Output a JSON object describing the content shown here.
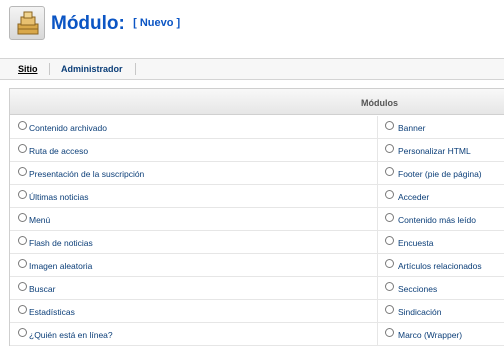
{
  "header": {
    "title": "Módulo:",
    "subtitle": "[ Nuevo ]",
    "icon": "module-manager-icon"
  },
  "tabs": [
    {
      "label": "Sitio",
      "active": true
    },
    {
      "label": "Administrador",
      "active": false
    }
  ],
  "panel": {
    "header": "Módulos",
    "left": [
      "Contenido archivado",
      "Ruta de acceso",
      "Presentación de la suscripción",
      "Últimas noticias",
      "Menú",
      "Flash de noticias",
      "Imagen aleatoria",
      "Buscar",
      "Estadísticas",
      "¿Quién está en línea?"
    ],
    "right": [
      "Banner",
      "Personalizar HTML",
      "Footer (pie de página)",
      "Acceder",
      "Contenido más leído",
      "Encuesta",
      "Artículos relacionados",
      "Secciones",
      "Sindicación",
      "Marco (Wrapper)"
    ]
  },
  "colors": {
    "link": "#0b3e78",
    "title": "#0b55c4"
  }
}
